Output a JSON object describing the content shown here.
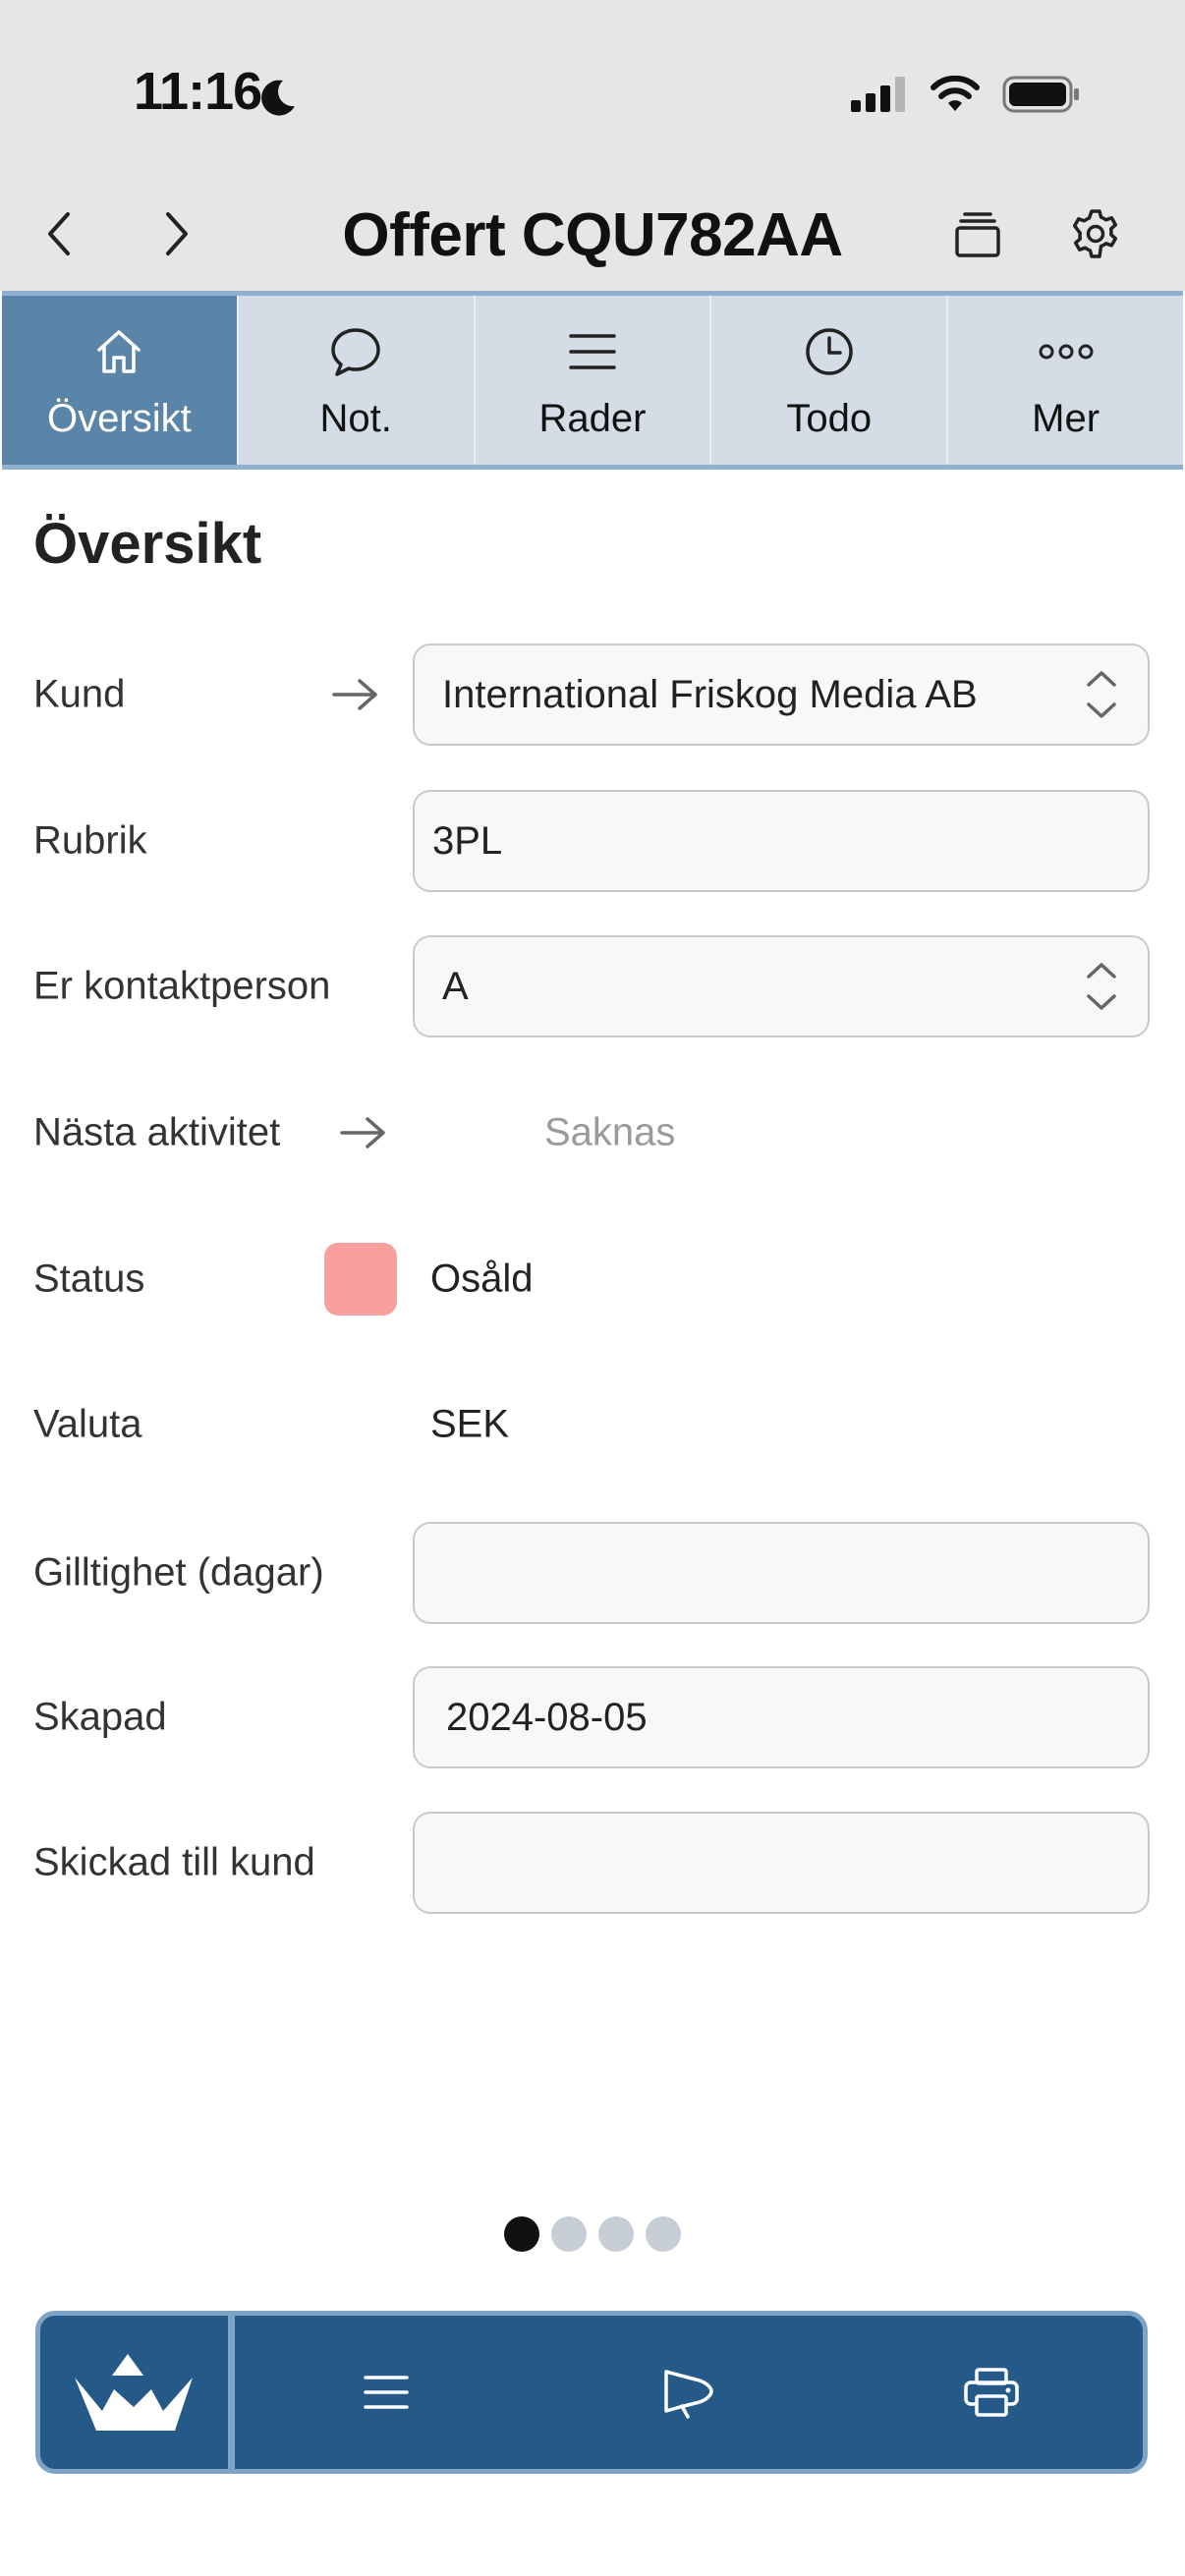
{
  "status_bar": {
    "time": "11:16"
  },
  "header": {
    "title": "Offert CQU782AA"
  },
  "tabs": [
    {
      "label": "Översikt",
      "icon": "home-icon",
      "active": true
    },
    {
      "label": "Not.",
      "icon": "chat-bubble-icon",
      "active": false
    },
    {
      "label": "Rader",
      "icon": "list-lines-icon",
      "active": false
    },
    {
      "label": "Todo",
      "icon": "clock-icon",
      "active": false
    },
    {
      "label": "Mer",
      "icon": "more-dots-icon",
      "active": false
    }
  ],
  "overview": {
    "title": "Översikt",
    "fields": {
      "kund": {
        "label": "Kund",
        "value": "International Friskog Media AB"
      },
      "rubrik": {
        "label": "Rubrik",
        "value": "3PL"
      },
      "kontaktperson": {
        "label": "Er kontaktperson",
        "value": "A"
      },
      "nasta_aktivitet": {
        "label": "Nästa aktivitet",
        "value": "Saknas"
      },
      "status": {
        "label": "Status",
        "value": "Osåld",
        "color": "#f7a09e"
      },
      "valuta": {
        "label": "Valuta",
        "value": "SEK"
      },
      "giltighet": {
        "label": "Gilltighet (dagar)",
        "value": ""
      },
      "skapad": {
        "label": "Skapad",
        "value": "2024-08-05"
      },
      "skickad": {
        "label": "Skickad till kund",
        "value": ""
      }
    }
  },
  "pager": {
    "pages": 4,
    "current": 1
  },
  "toolbar": {
    "accent": "#255987",
    "icons": [
      "logo-boat-icon",
      "menu-icon",
      "megaphone-icon",
      "printer-icon"
    ]
  }
}
